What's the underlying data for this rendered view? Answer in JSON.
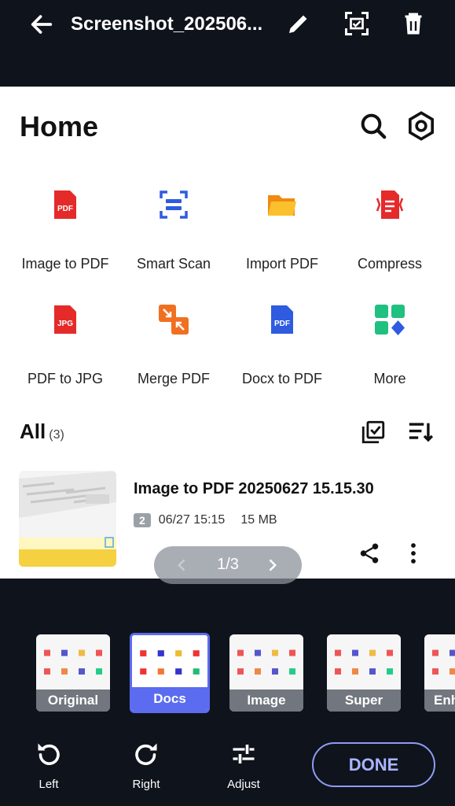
{
  "topbar": {
    "title": "Screenshot_202506...",
    "icons": [
      "back-arrow-icon",
      "pencil-icon",
      "crop-scan-icon",
      "trash-icon"
    ]
  },
  "page": {
    "home_title": "Home",
    "tools": [
      {
        "label": "Image to PDF",
        "icon": "pdf-file-icon",
        "badge": "PDF",
        "color": "#e52a2a"
      },
      {
        "label": "Smart Scan",
        "icon": "scan-icon",
        "color": "#2f5be0"
      },
      {
        "label": "Import PDF",
        "icon": "folder-icon",
        "color": "#f5a020"
      },
      {
        "label": "Compress",
        "icon": "compress-icon",
        "color": "#e52a2a"
      },
      {
        "label": "PDF to JPG",
        "icon": "jpg-file-icon",
        "badge": "JPG",
        "color": "#e52a2a"
      },
      {
        "label": "Merge PDF",
        "icon": "merge-icon",
        "color": "#f07020"
      },
      {
        "label": "Docx to PDF",
        "icon": "docx-file-icon",
        "badge": "PDF",
        "color": "#2f5be0"
      },
      {
        "label": "More",
        "icon": "grid-more-icon",
        "color": "#20c080"
      }
    ],
    "all_label": "All",
    "all_count": "(3)",
    "file": {
      "name": "Image to PDF 20250627 15.15.30",
      "pages": "2",
      "date": "06/27 15:15",
      "size": "15 MB"
    },
    "pager": "1/3"
  },
  "filters": [
    {
      "label": "Original",
      "selected": false
    },
    {
      "label": "Docs",
      "selected": true
    },
    {
      "label": "Image",
      "selected": false
    },
    {
      "label": "Super",
      "selected": false
    },
    {
      "label": "Enh",
      "selected": false
    }
  ],
  "controls": {
    "left": "Left",
    "right": "Right",
    "adjust": "Adjust",
    "done": "DONE"
  },
  "colors": {
    "background": "#0f131c",
    "accent": "#5b6cf0",
    "done_border": "#8e9cf3"
  }
}
